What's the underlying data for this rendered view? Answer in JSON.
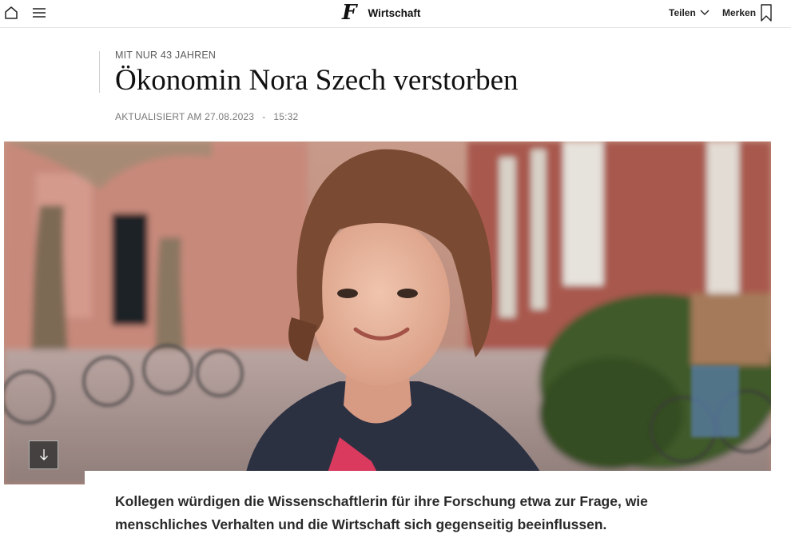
{
  "nav": {
    "brand_logo": "F",
    "section": "Wirtschaft",
    "share_label": "Teilen",
    "bookmark_label": "Merken"
  },
  "article": {
    "kicker": "MIT NUR 43 JAHREN",
    "title": "Ökonomin Nora Szech verstorben",
    "updated_label": "AKTUALISIERT AM 27.08.2023",
    "separator": "-",
    "time": "15:32",
    "teaser": "Kollegen würdigen die Wissenschaftlerin für ihre Forschung etwa zur Frage, wie menschliches Verhalten und die Wirtschaft sich gegenseitig beeinflussen."
  },
  "icons": {
    "home": "home-icon",
    "menu": "menu-icon",
    "share_chevron": "chevron-down-icon",
    "bookmark": "bookmark-icon",
    "scroll_down": "arrow-down-icon"
  }
}
